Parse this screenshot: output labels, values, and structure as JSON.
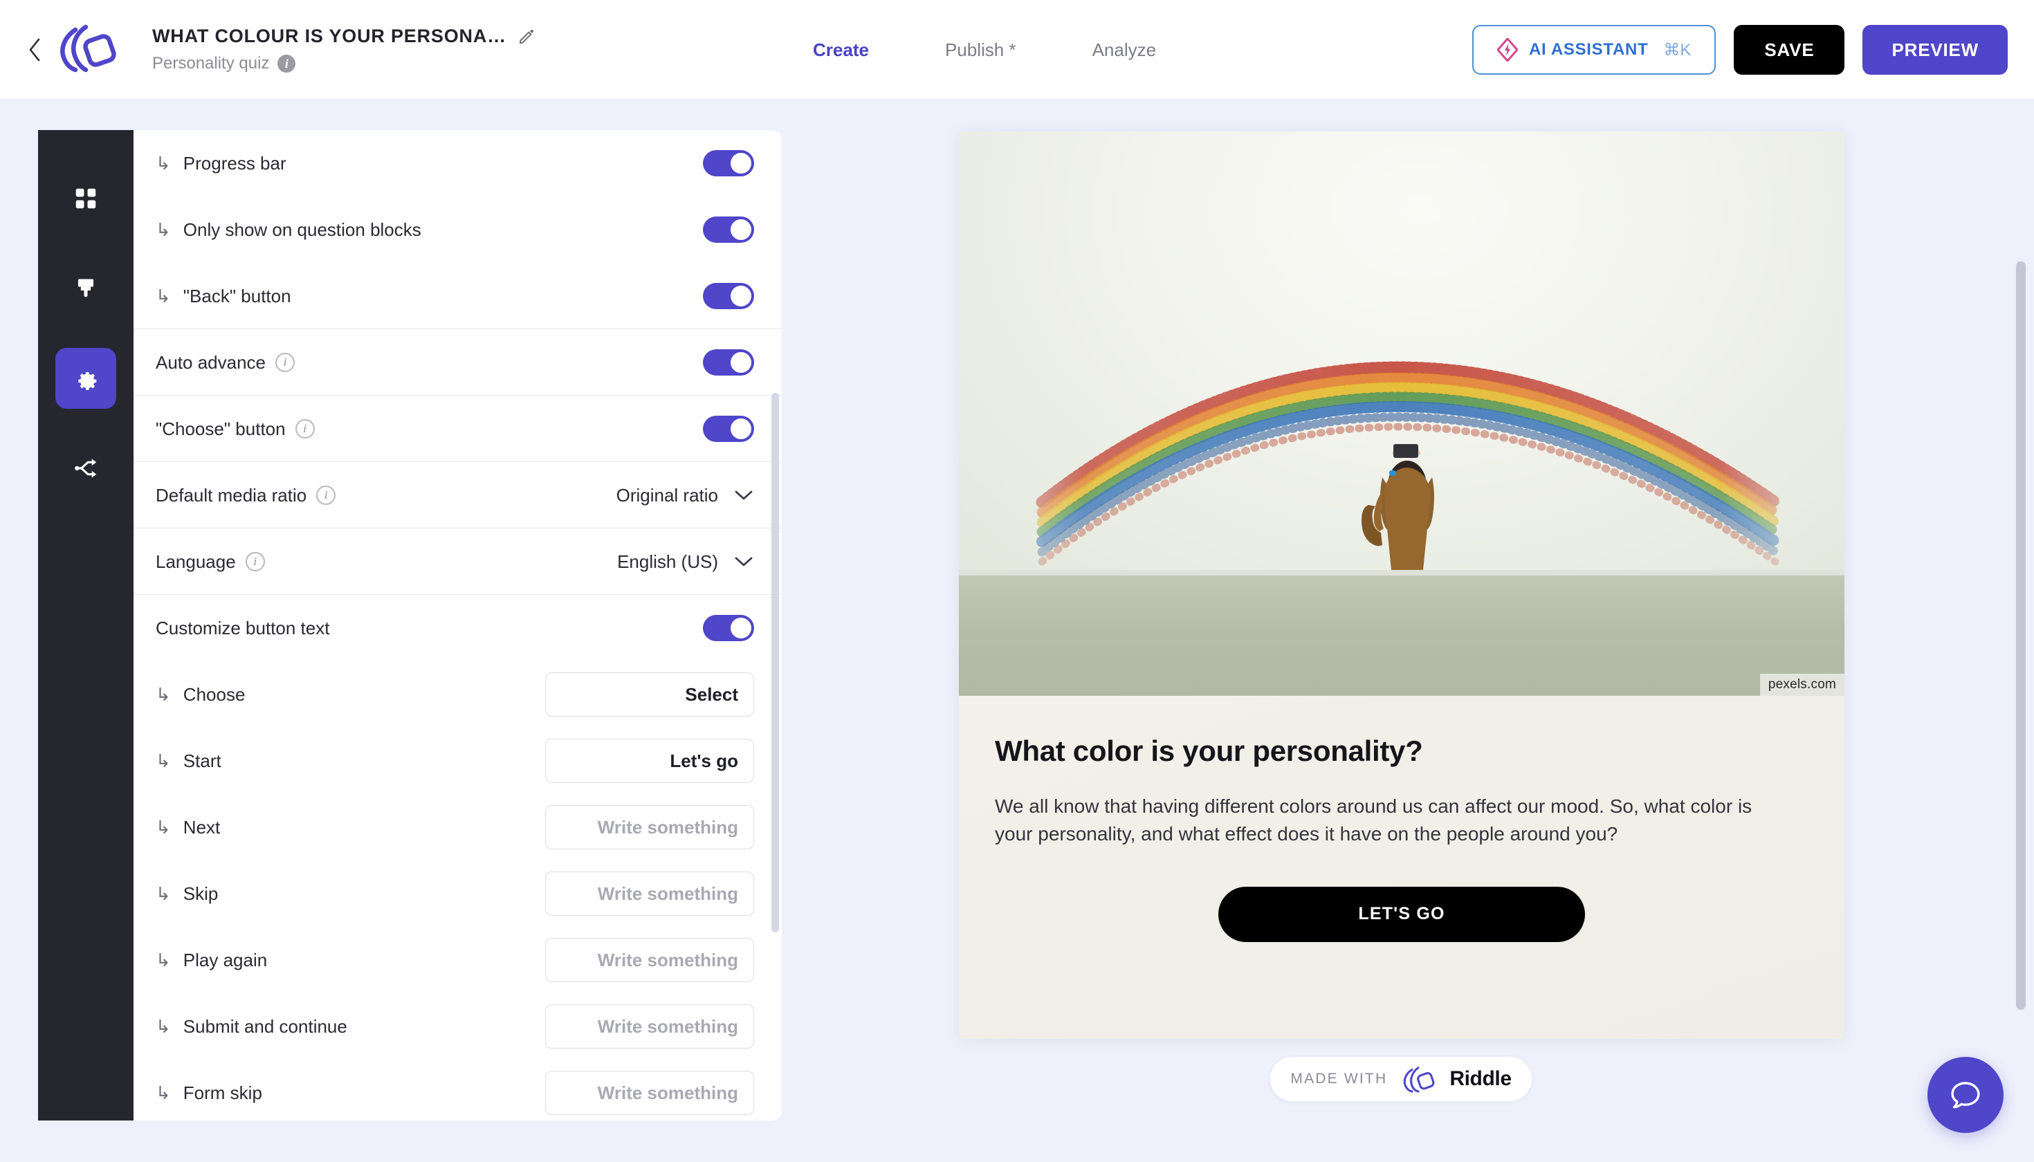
{
  "header": {
    "back_icon": "chevron-left-icon",
    "logo_icon": "riddle-logo-icon",
    "title": "WHAT COLOUR IS YOUR PERSONA…",
    "edit_icon": "pencil-icon",
    "subtitle": "Personality quiz",
    "subtitle_info_icon": "info-icon",
    "tabs": [
      {
        "label": "Create",
        "active": true
      },
      {
        "label": "Publish *",
        "active": false
      },
      {
        "label": "Analyze",
        "active": false
      }
    ],
    "ai_assistant": {
      "label": "AI ASSISTANT",
      "shortcut": "⌘K",
      "icon": "ai-sparkle-icon"
    },
    "save_label": "SAVE",
    "preview_label": "PREVIEW"
  },
  "rail": {
    "items": [
      {
        "name": "blocks",
        "icon": "grid-icon",
        "active": false
      },
      {
        "name": "design",
        "icon": "paintbrush-icon",
        "active": false
      },
      {
        "name": "settings",
        "icon": "gear-icon",
        "active": true
      },
      {
        "name": "logic",
        "icon": "share-nodes-icon",
        "active": false
      }
    ]
  },
  "settings": {
    "toggle_rows": [
      {
        "label": "Progress bar",
        "indented": true,
        "info": false,
        "on": true
      },
      {
        "label": "Only show on question blocks",
        "indented": true,
        "info": false,
        "on": true
      },
      {
        "label": "\"Back\" button",
        "indented": true,
        "info": false,
        "on": true,
        "group_end": true
      },
      {
        "label": "Auto advance",
        "indented": false,
        "info": true,
        "on": true,
        "group_end": true
      },
      {
        "label": "\"Choose\" button",
        "indented": false,
        "info": true,
        "on": true,
        "group_end": true
      }
    ],
    "select_rows": [
      {
        "label": "Default media ratio",
        "info": true,
        "value": "Original ratio"
      },
      {
        "label": "Language",
        "info": true,
        "value": "English (US)"
      }
    ],
    "customize_row": {
      "label": "Customize button text",
      "on": true
    },
    "button_text_rows": [
      {
        "label": "Choose",
        "value": "Select",
        "placeholder": "Write something"
      },
      {
        "label": "Start",
        "value": "Let's go",
        "placeholder": "Write something"
      },
      {
        "label": "Next",
        "value": "",
        "placeholder": "Write something"
      },
      {
        "label": "Skip",
        "value": "",
        "placeholder": "Write something"
      },
      {
        "label": "Play again",
        "value": "",
        "placeholder": "Write something"
      },
      {
        "label": "Submit and continue",
        "value": "",
        "placeholder": "Write something"
      },
      {
        "label": "Form skip",
        "value": "",
        "placeholder": "Write something"
      }
    ],
    "indent_glyph": "↳",
    "chevron_icon": "chevron-down-icon"
  },
  "preview": {
    "image_watermark": "pexels.com",
    "image_alt_icon": "rainbow-wall-photo",
    "question_title": "What color is your personality?",
    "description": "We all know that having different colors around us can affect our mood. So, what color is your personality, and what effect does it have on the people around you?",
    "cta_label": "LET'S GO",
    "made_with_label": "MADE WITH",
    "made_with_brand": "Riddle",
    "made_with_icon": "riddle-logo-icon"
  },
  "chat": {
    "icon": "chat-bubble-icon"
  },
  "colors": {
    "accent": "#4f46c9",
    "rail_bg": "#26262f",
    "page_bg": "#eef1fb",
    "ai_border": "#4d8fd6",
    "ai_text": "#2f6fcf"
  }
}
